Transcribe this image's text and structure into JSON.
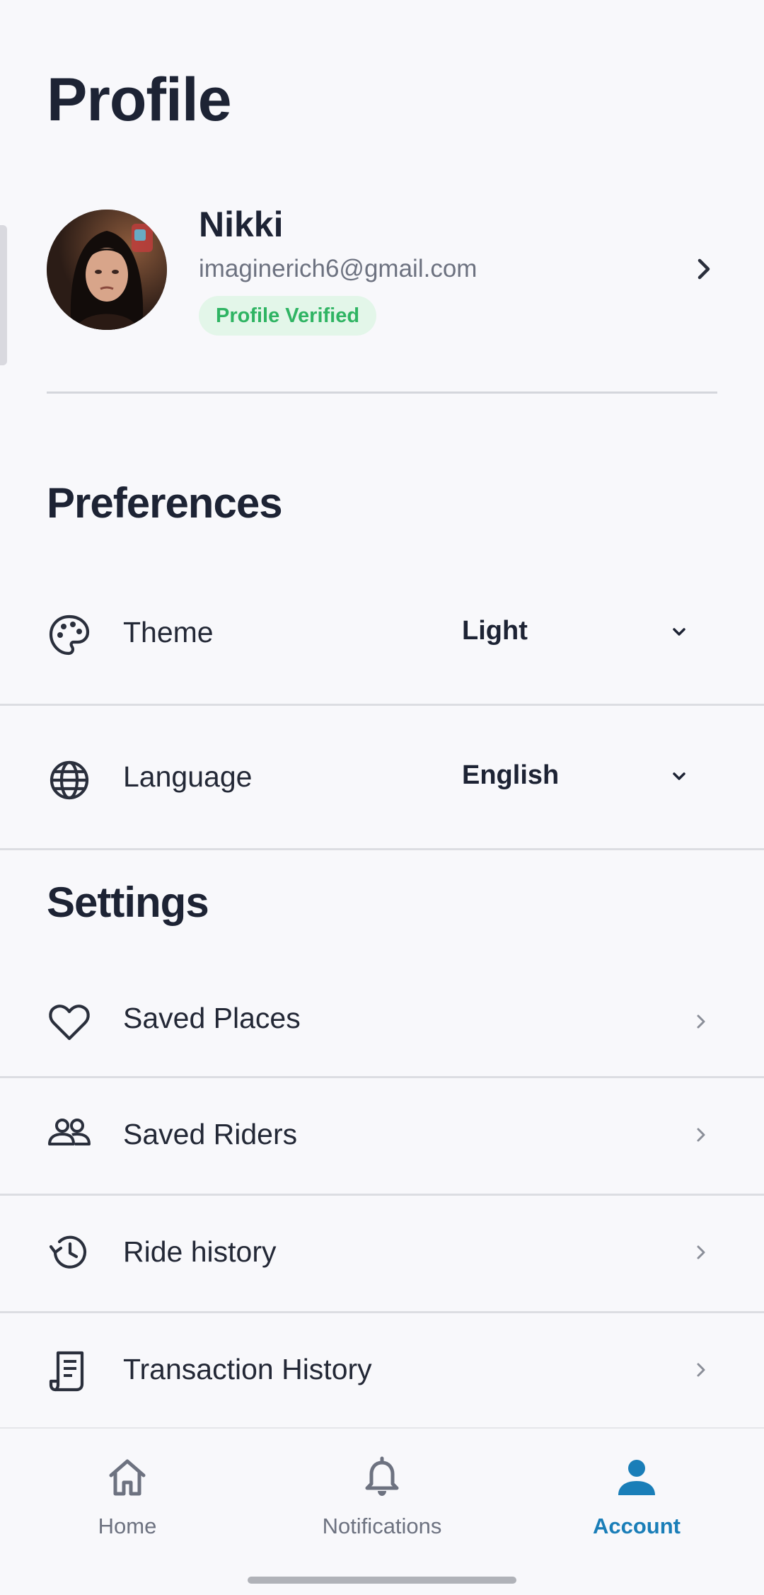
{
  "header": {
    "title": "Profile"
  },
  "profile": {
    "name": "Nikki",
    "email": "imaginerich6@gmail.com",
    "badge": "Profile Verified"
  },
  "preferences": {
    "title": "Preferences",
    "items": [
      {
        "label": "Theme",
        "value": "Light",
        "icon": "palette-icon"
      },
      {
        "label": "Language",
        "value": "English",
        "icon": "globe-icon"
      }
    ]
  },
  "settings": {
    "title": "Settings",
    "items": [
      {
        "label": "Saved Places",
        "icon": "heart-icon"
      },
      {
        "label": "Saved Riders",
        "icon": "people-icon"
      },
      {
        "label": "Ride history",
        "icon": "history-icon"
      },
      {
        "label": "Transaction History",
        "icon": "receipt-icon"
      }
    ]
  },
  "nav": {
    "items": [
      {
        "label": "Home",
        "icon": "home-icon",
        "active": false
      },
      {
        "label": "Notifications",
        "icon": "bell-icon",
        "active": false
      },
      {
        "label": "Account",
        "icon": "account-icon",
        "active": true
      }
    ]
  },
  "colors": {
    "accent": "#1a7eb8",
    "verified_text": "#2fb463",
    "verified_bg": "#e3f6e9",
    "background": "#f8f8fb"
  }
}
